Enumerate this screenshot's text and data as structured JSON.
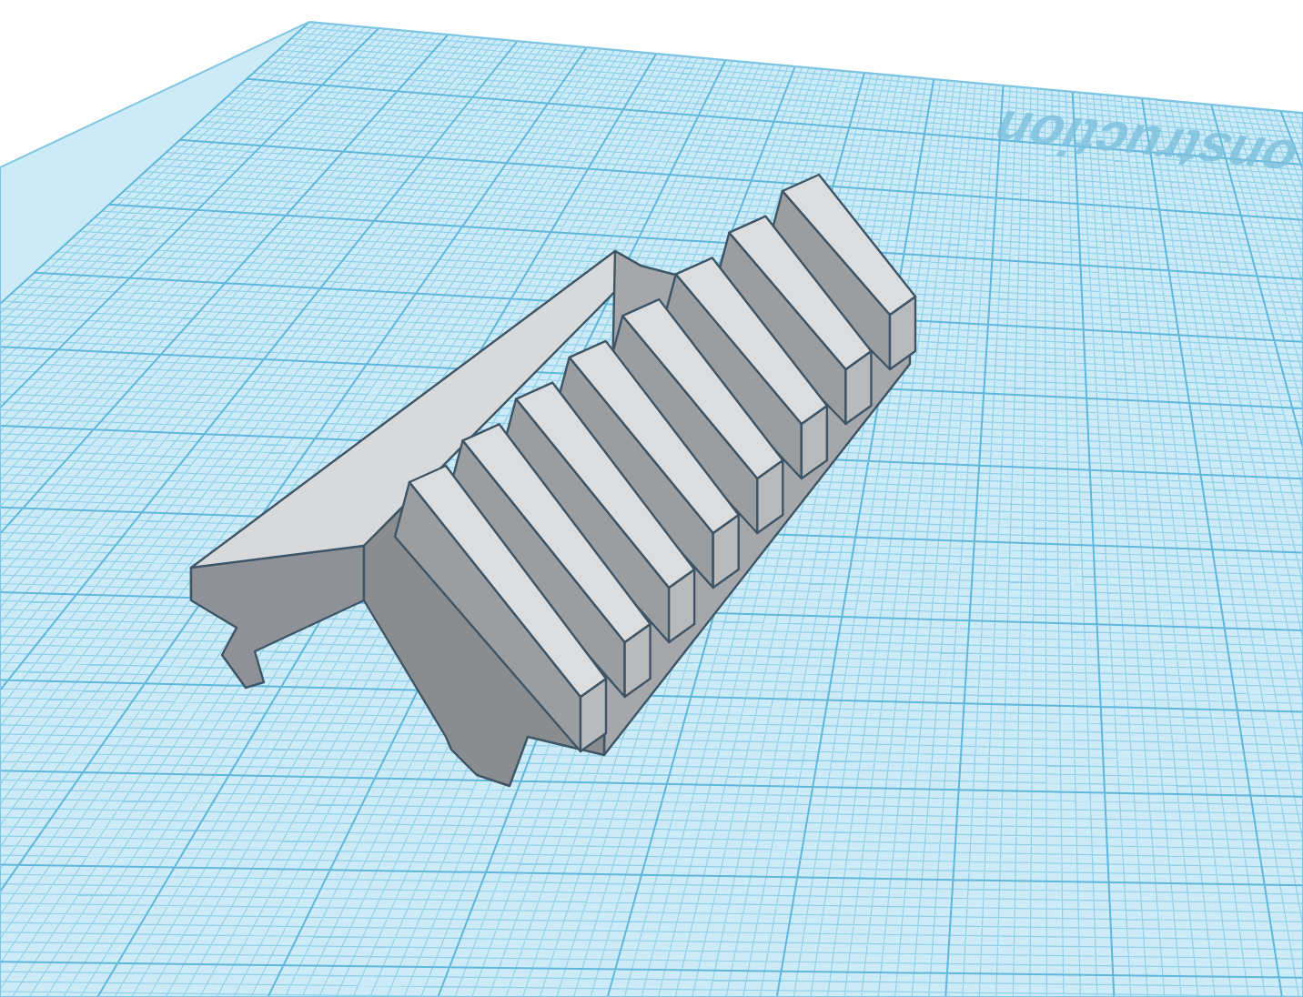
{
  "workplane": {
    "label": "onstruction"
  }
}
